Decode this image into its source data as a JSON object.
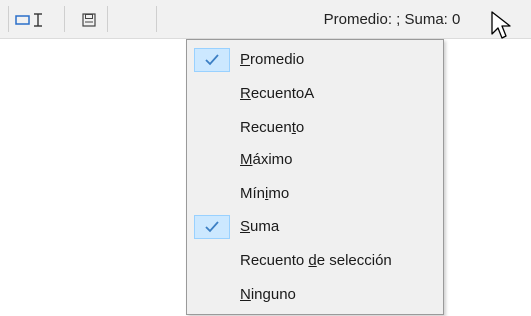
{
  "status_bar": {
    "summary_text": "Promedio: ; Suma: 0",
    "icons": [
      "selection-mode-icon",
      "save-document-icon"
    ]
  },
  "context_menu": {
    "items": [
      {
        "before": "",
        "underline": "P",
        "after": "romedio",
        "checked": true
      },
      {
        "before": "",
        "underline": "R",
        "after": "ecuentoA",
        "checked": false
      },
      {
        "before": "Recuen",
        "underline": "t",
        "after": "o",
        "checked": false
      },
      {
        "before": "",
        "underline": "M",
        "after": "áximo",
        "checked": false
      },
      {
        "before": "Mín",
        "underline": "i",
        "after": "mo",
        "checked": false
      },
      {
        "before": "",
        "underline": "S",
        "after": "uma",
        "checked": true
      },
      {
        "before": "Recuento ",
        "underline": "d",
        "after": "e selección",
        "checked": false
      },
      {
        "before": "",
        "underline": "N",
        "after": "inguno",
        "checked": false
      }
    ],
    "check_color": "#3c7fc4"
  }
}
